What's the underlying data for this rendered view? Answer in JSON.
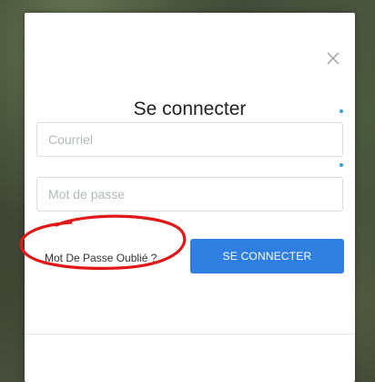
{
  "modal": {
    "title": "Se connecter",
    "close_icon": "close-icon",
    "email_placeholder": "Courriel",
    "password_placeholder": "Mot de passe",
    "forgot_password_label": "Mot De Passe Oublié ?",
    "submit_label": "SE CONNECTER"
  },
  "colors": {
    "accent": "#2f7fe0",
    "indicator_dot": "#29a3e0",
    "annotation_circle": "#e01818"
  }
}
